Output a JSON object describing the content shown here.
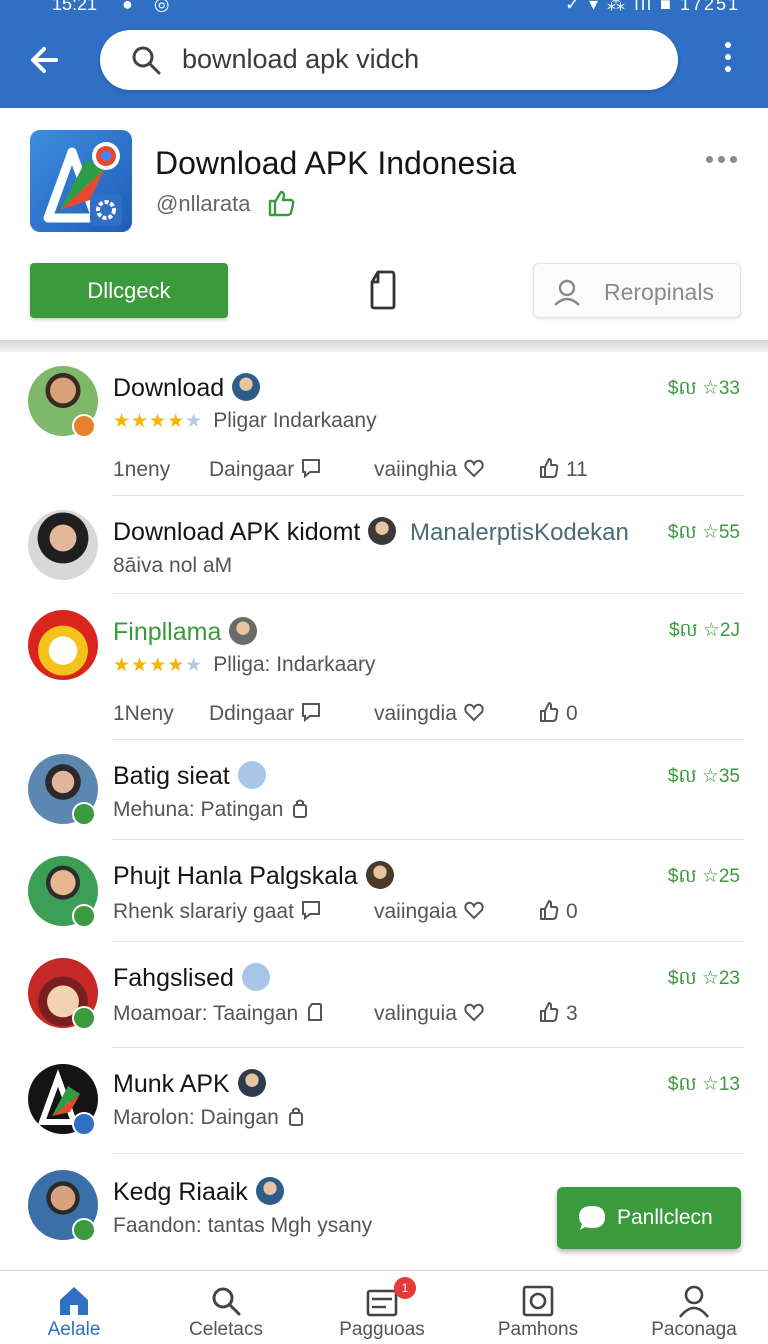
{
  "status_bar": {
    "time": "15:21",
    "right": "17251"
  },
  "search": {
    "query": "bownload apk vidch"
  },
  "app": {
    "title": "Download APK Indonesia",
    "handle": "@nllarata",
    "primary_button": "Dllcgeck",
    "secondary_button": "Reropinals"
  },
  "results": [
    {
      "name": "Download",
      "name_color": "dark",
      "rating": 4,
      "subtitle": "Pligar Indarkaany",
      "price": "$ល ☆33",
      "actions": [
        "1neny",
        "Daingaar",
        "vaiinghia",
        "11"
      ]
    },
    {
      "name": "Download APK kidomt",
      "name_color": "dark",
      "rating": 0,
      "subtitle": "8āiva nol aM",
      "price": "$ល ☆55",
      "extra": "ManalerptisKodekan"
    },
    {
      "name": "Finpllama",
      "name_color": "green",
      "rating": 4,
      "subtitle": "Plliga: Indarkaary",
      "price": "$ល ☆2J",
      "actions": [
        "1Neny",
        "Ddingaar",
        "vaiingdia",
        "0"
      ]
    },
    {
      "name": "Batig sieat",
      "name_color": "dark",
      "rating": 0,
      "subtitle": "Mehuna: Patingan",
      "price": "$ល ☆35"
    },
    {
      "name": "Phujt Hanla Palgskala",
      "name_color": "dark",
      "rating": 0,
      "subtitle": "Rhenk slarariy gaat",
      "price": "$ល ☆25",
      "inline_actions": [
        "vaiingaia",
        "0"
      ]
    },
    {
      "name": "Fahgslised",
      "name_color": "dark",
      "rating": 0,
      "subtitle": "Moamoar: Taaingan",
      "price": "$ល ☆23",
      "inline_actions": [
        "valinguia",
        "3"
      ]
    },
    {
      "name": "Munk APK",
      "name_color": "dark",
      "rating": 0,
      "subtitle": "Marolon: Daingan",
      "price": "$ល ☆13"
    },
    {
      "name": "Kedg Riaaik",
      "name_color": "dark",
      "rating": 0,
      "subtitle": "Faandon: tantas Mgh ysany",
      "price": ""
    }
  ],
  "fab": {
    "label": "Panllclecn"
  },
  "bottom_nav": [
    {
      "label": "Aelale",
      "icon": "home-icon",
      "active": true
    },
    {
      "label": "Celetacs",
      "icon": "search-icon",
      "active": false
    },
    {
      "label": "Pagguoas",
      "icon": "inbox-icon",
      "active": false,
      "badge": "1"
    },
    {
      "label": "Pamhons",
      "icon": "photo-icon",
      "active": false
    },
    {
      "label": "Paconaga",
      "icon": "profile-icon",
      "active": false
    }
  ],
  "colors": {
    "appbar": "#2f6fc4",
    "accent_green": "#3a9a3c",
    "star": "#f4b400"
  }
}
